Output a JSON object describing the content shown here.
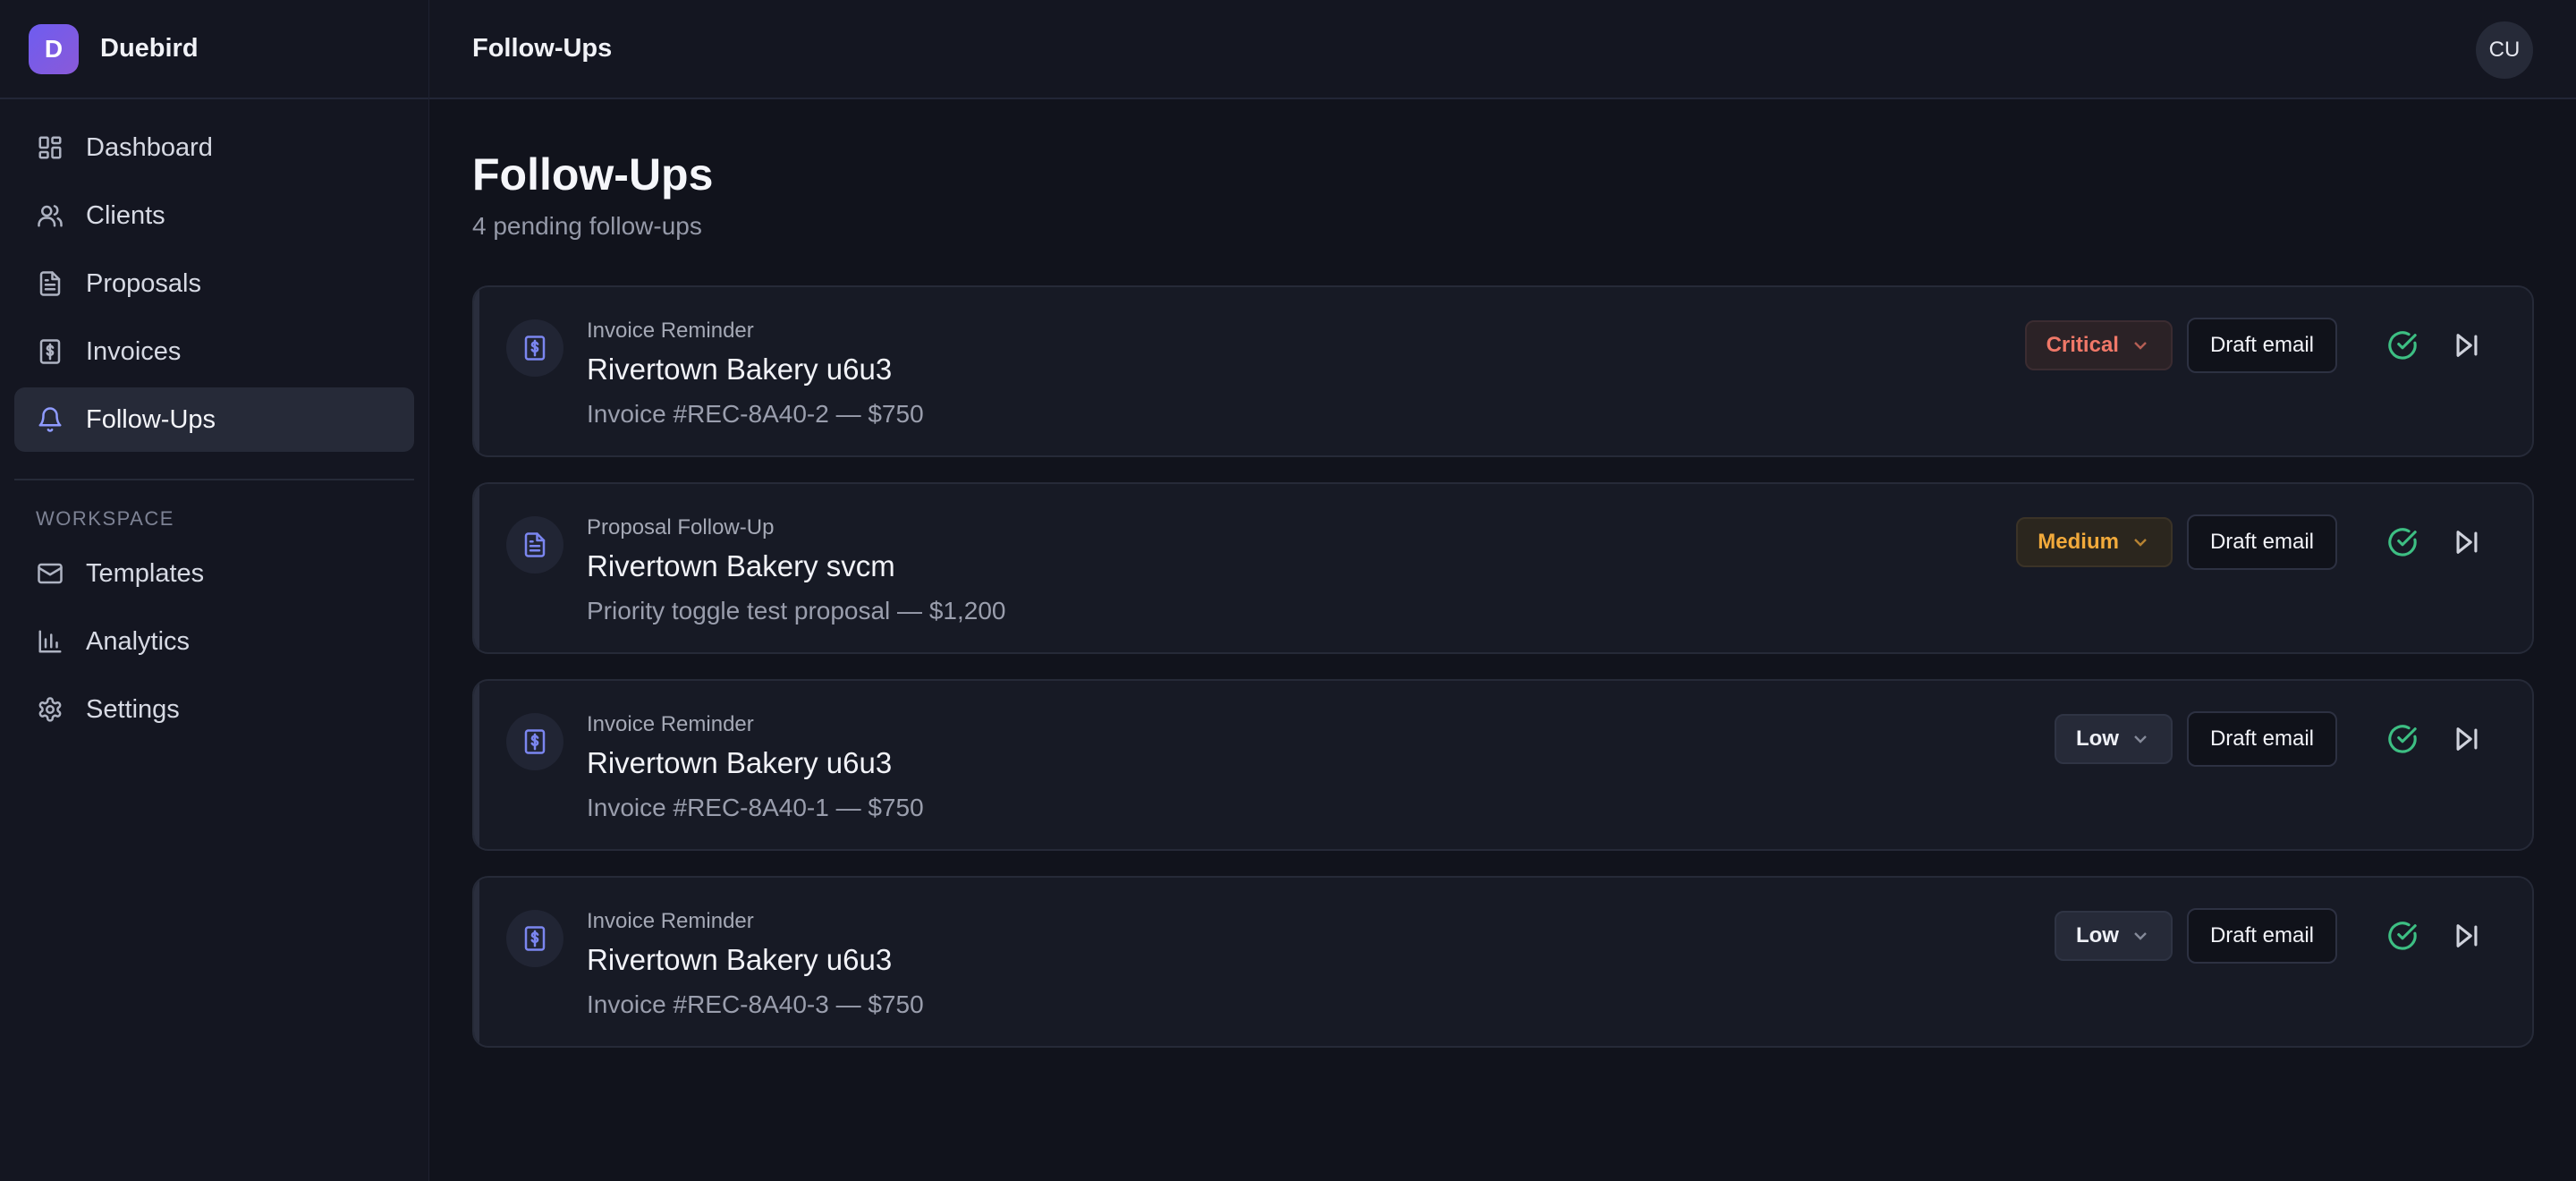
{
  "app": {
    "name": "Duebird",
    "logo_letter": "D"
  },
  "sidebar": {
    "items": [
      {
        "label": "Dashboard",
        "icon": "dashboard-icon"
      },
      {
        "label": "Clients",
        "icon": "users-icon"
      },
      {
        "label": "Proposals",
        "icon": "file-text-icon"
      },
      {
        "label": "Invoices",
        "icon": "receipt-icon"
      },
      {
        "label": "Follow-Ups",
        "icon": "bell-icon",
        "active": true
      }
    ],
    "section_label": "WORKSPACE",
    "workspace_items": [
      {
        "label": "Templates",
        "icon": "mail-icon"
      },
      {
        "label": "Analytics",
        "icon": "bar-chart-icon"
      },
      {
        "label": "Settings",
        "icon": "gear-icon"
      }
    ]
  },
  "topbar": {
    "title": "Follow-Ups",
    "avatar": "CU"
  },
  "main": {
    "title": "Follow-Ups",
    "subtitle": "4 pending follow-ups"
  },
  "followups": [
    {
      "kind": "Invoice Reminder",
      "client": "Rivertown Bakery u6u3",
      "desc": "Invoice #REC-8A40-2 — $750",
      "priority": "Critical",
      "icon": "receipt-icon",
      "action": "Draft email"
    },
    {
      "kind": "Proposal Follow-Up",
      "client": "Rivertown Bakery svcm",
      "desc": "Priority toggle test proposal — $1,200",
      "priority": "Medium",
      "icon": "file-text-icon",
      "action": "Draft email"
    },
    {
      "kind": "Invoice Reminder",
      "client": "Rivertown Bakery u6u3",
      "desc": "Invoice #REC-8A40-1 — $750",
      "priority": "Low",
      "icon": "receipt-icon",
      "action": "Draft email"
    },
    {
      "kind": "Invoice Reminder",
      "client": "Rivertown Bakery u6u3",
      "desc": "Invoice #REC-8A40-3 — $750",
      "priority": "Low",
      "icon": "receipt-icon",
      "action": "Draft email"
    }
  ],
  "colors": {
    "accent": "#7b86f0",
    "critical": "#f07868",
    "medium": "#f2aa3b",
    "success": "#3dbf83",
    "background": "#11131c"
  }
}
